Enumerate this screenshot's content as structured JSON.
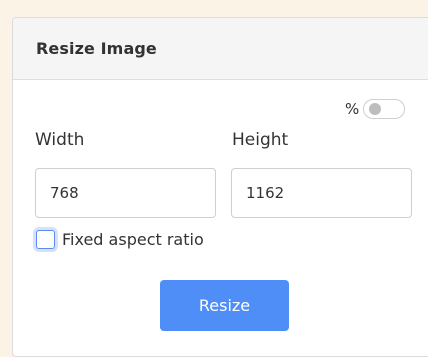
{
  "panel": {
    "title": "Resize Image"
  },
  "percent_toggle": {
    "label": "%",
    "checked": false
  },
  "width_field": {
    "label": "Width",
    "value": "768"
  },
  "height_field": {
    "label": "Height",
    "value": "1162"
  },
  "aspect_ratio": {
    "label": "Fixed aspect ratio",
    "checked": false
  },
  "resize_button": {
    "label": "Resize"
  },
  "colors": {
    "accent": "#4f8ef7",
    "background": "#fbf3e6"
  }
}
